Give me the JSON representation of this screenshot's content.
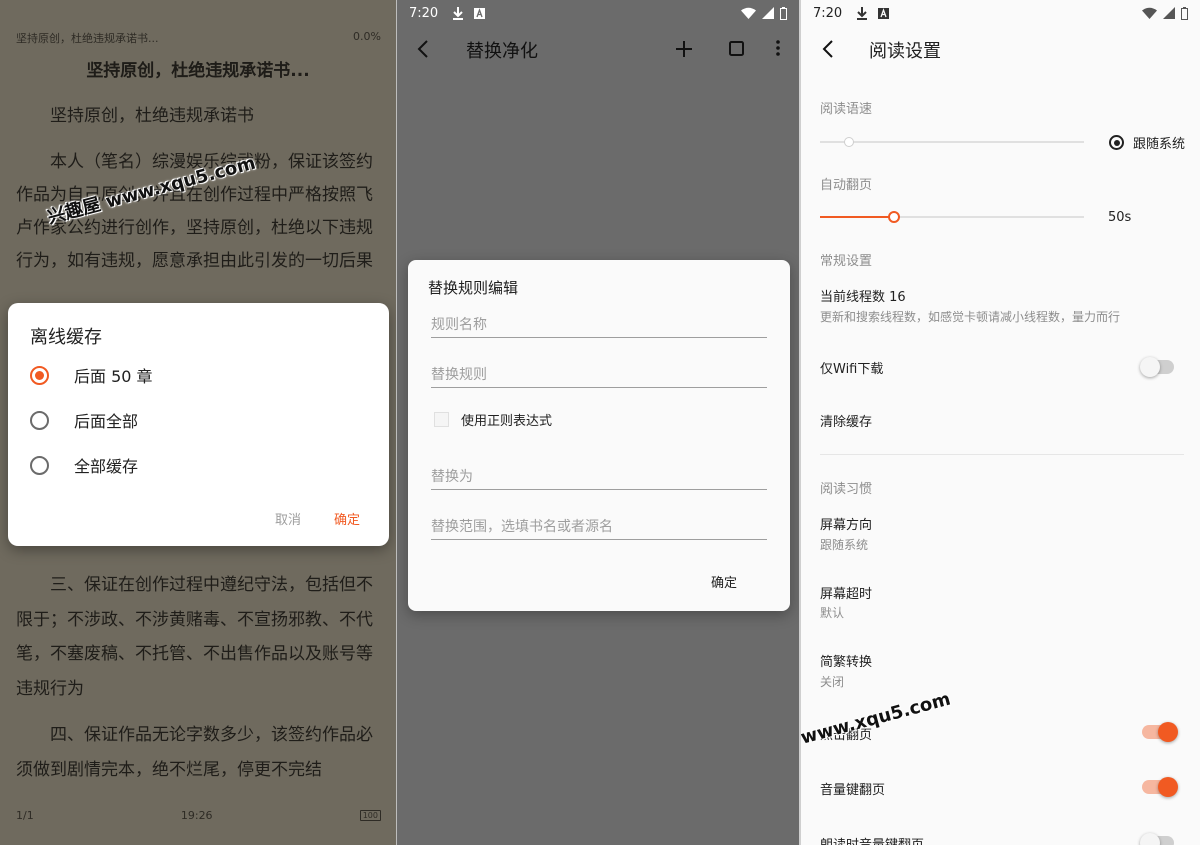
{
  "reader": {
    "top_title": "坚持原创，杜绝违规承诺书...",
    "progress": "0.0%",
    "chapter_title": "坚持原创，杜绝违规承诺书...",
    "paragraphs": [
      "坚持原创，杜绝违规承诺书",
      "本人（笔名）综漫娱乐综武粉，保证该签约作品为自己原创，并且在创作过程中严格按照飞卢作家公约进行创作，坚持原创，杜绝以下违规行为，如有违规，愿意承担由此引发的一切后果"
    ],
    "lower_paragraphs": [
      "三、保证在创作过程中遵纪守法，包括但不限于；不涉政、不涉黄赌毒、不宣扬邪教、不代笔，不塞废稿、不托管、不出售作品以及账号等违规行为",
      "四、保证作品无论字数多少，该签约作品必须做到剧情完本，绝不烂尾，停更不完结"
    ],
    "page": "1/1",
    "clock": "19:26",
    "battery": "100"
  },
  "offline_dialog": {
    "title": "离线缓存",
    "options": [
      "后面 50 章",
      "后面全部",
      "全部缓存"
    ],
    "selected": 0,
    "cancel": "取消",
    "confirm": "确定"
  },
  "status": {
    "time": "7:20"
  },
  "replace_screen": {
    "title": "替换净化",
    "add_icon": "plus-icon",
    "select_icon": "checkbox-icon",
    "more_icon": "more-vert-icon"
  },
  "replace_dialog": {
    "title": "替换规则编辑",
    "rule_name_placeholder": "规则名称",
    "rule_placeholder": "替换规则",
    "regex_label": "使用正则表达式",
    "replace_with_placeholder": "替换为",
    "scope_placeholder": "替换范围，选填书名或者源名",
    "confirm": "确定"
  },
  "settings": {
    "title": "阅读设置",
    "speech_rate_header": "阅读语速",
    "follow_system": "跟随系统",
    "auto_page_header": "自动翻页",
    "auto_page_value": "50s",
    "auto_page_fraction": 0.28,
    "general_header": "常规设置",
    "threads_title": "当前线程数 16",
    "threads_desc": "更新和搜索线程数，如感觉卡顿请减小线程数，量力而行",
    "wifi_only": "仅Wifi下载",
    "wifi_only_on": false,
    "clear_cache": "清除缓存",
    "habits_header": "阅读习惯",
    "orientation_title": "屏幕方向",
    "orientation_value": "跟随系统",
    "timeout_title": "屏幕超时",
    "timeout_value": "默认",
    "convert_title": "简繁转换",
    "convert_value": "关闭",
    "click_page": "点击翻页",
    "click_page_on": true,
    "volume_page": "音量键翻页",
    "volume_page_on": true,
    "tts_volume_page": "朗读时音量键翻页",
    "tts_volume_page_on": false
  },
  "colors": {
    "accent": "#f15a22",
    "reader_bg": "#6f6a5e"
  },
  "watermark": "兴趣屋 www.xqu5.com"
}
